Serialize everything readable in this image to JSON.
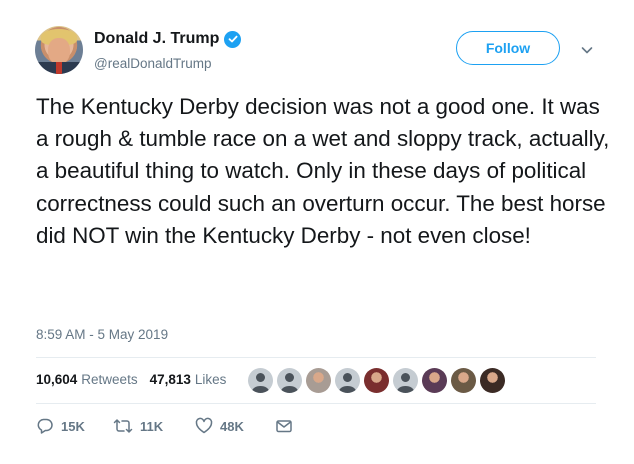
{
  "author": {
    "display_name": "Donald J. Trump",
    "handle": "@realDonaldTrump",
    "verified": true
  },
  "follow_label": "Follow",
  "tweet": {
    "text": "The Kentucky Derby decision was not a good one. It was a rough & tumble race on a wet and sloppy track, actually, a beautiful thing to watch. Only in these days of political correctness could such an overturn occur. The best horse did NOT win the Kentucky Derby - not even close!",
    "timestamp": "8:59 AM - 5 May 2019"
  },
  "stats": {
    "retweets_count": "10,604",
    "retweets_label": "Retweets",
    "likes_count": "47,813",
    "likes_label": "Likes"
  },
  "retweeter_avatars": [
    {
      "kind": "default",
      "color": "#9aa3ab"
    },
    {
      "kind": "default",
      "color": "#9aa3ab"
    },
    {
      "kind": "photo",
      "color": "#a89c94"
    },
    {
      "kind": "default",
      "color": "#9aa3ab"
    },
    {
      "kind": "photo",
      "color": "#7a2e2e"
    },
    {
      "kind": "default",
      "color": "#9aa3ab"
    },
    {
      "kind": "photo",
      "color": "#5a3b56"
    },
    {
      "kind": "photo",
      "color": "#6b5a45"
    },
    {
      "kind": "photo",
      "color": "#3b2a24"
    }
  ],
  "actions": {
    "reply_count": "15K",
    "retweet_count": "11K",
    "like_count": "48K"
  },
  "colors": {
    "accent": "#1da1f2",
    "text": "#14171a",
    "secondary": "#657786",
    "divider": "#e6ecf0"
  }
}
